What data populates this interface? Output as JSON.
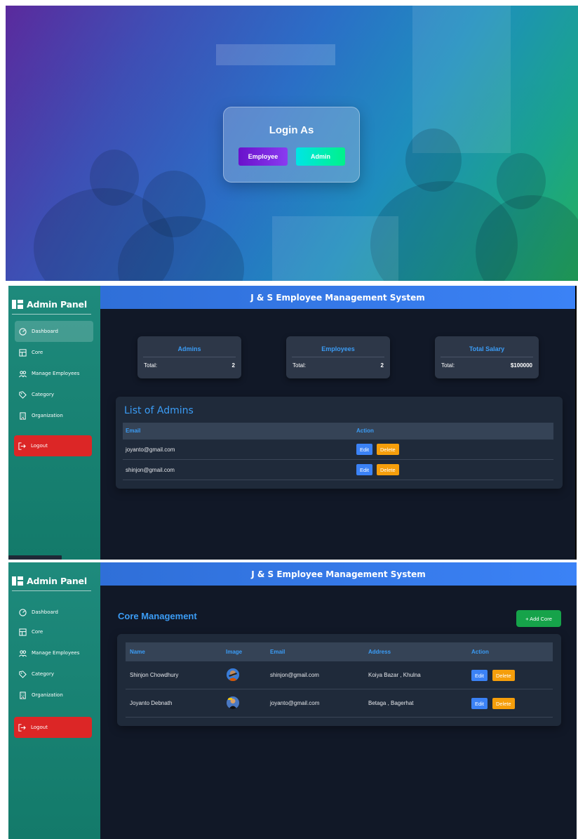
{
  "login": {
    "title": "Login As",
    "employee_button": "Employee",
    "admin_button": "Admin"
  },
  "sidebar": {
    "brand": "Admin Panel",
    "items": [
      {
        "label": "Dashboard",
        "icon": "dashboard-icon"
      },
      {
        "label": "Core",
        "icon": "grid-icon"
      },
      {
        "label": "Manage Employees",
        "icon": "users-icon"
      },
      {
        "label": "Category",
        "icon": "tag-icon"
      },
      {
        "label": "Organization",
        "icon": "building-icon"
      }
    ],
    "logout": "Logout"
  },
  "header": {
    "title": "J & S Employee Management System"
  },
  "dashboard": {
    "stats": [
      {
        "title": "Admins",
        "label": "Total:",
        "value": "2"
      },
      {
        "title": "Employees",
        "label": "Total:",
        "value": "2"
      },
      {
        "title": "Total Salary",
        "label": "Total:",
        "value": "$100000"
      }
    ],
    "admins_title": "List of Admins",
    "admins_columns": [
      "Email",
      "Action"
    ],
    "admins": [
      {
        "email": "joyanto@gmail.com"
      },
      {
        "email": "shinjon@gmail.com"
      }
    ],
    "edit_label": "Edit",
    "delete_label": "Delete"
  },
  "core": {
    "title": "Core Management",
    "add_button": "+ Add Core",
    "columns": [
      "Name",
      "Image",
      "Email",
      "Address",
      "Action"
    ],
    "rows": [
      {
        "name": "Shinjon Chowdhury",
        "email": "shinjon@gmail.com",
        "address": "Koiya Bazar , Khulna"
      },
      {
        "name": "Joyanto Debnath",
        "email": "joyanto@gmail.com",
        "address": "Betaga , Bagerhat"
      }
    ],
    "edit_label": "Edit",
    "delete_label": "Delete"
  },
  "colors": {
    "sidebar": "#137a6a",
    "header": "#3b82f6",
    "accent_text": "#3b9cf5",
    "logout": "#dc2626",
    "edit": "#3b82f6",
    "delete": "#f59e0b",
    "add": "#16a34a"
  }
}
